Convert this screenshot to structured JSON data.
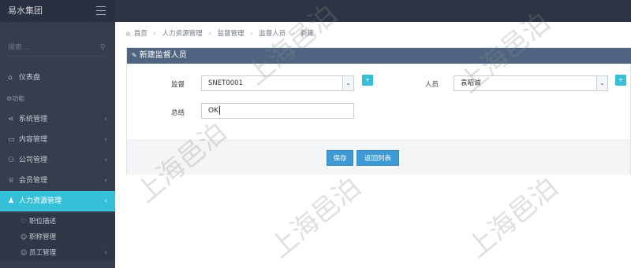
{
  "topbar": {
    "brand": "易水集团",
    "menu_icon": "hamburger-icon"
  },
  "sidebar": {
    "search_placeholder": "搜索...",
    "search_icon": "search-icon",
    "dashboard": {
      "label": "仪表盘",
      "icon": "home-icon"
    },
    "section_label": "功能",
    "items": [
      {
        "label": "系统管理",
        "icon": "share-icon"
      },
      {
        "label": "内容管理",
        "icon": "card-icon"
      },
      {
        "label": "公司管理",
        "icon": "sitemap-icon"
      },
      {
        "label": "会员管理",
        "icon": "graduation-icon"
      },
      {
        "label": "人力资源管理",
        "icon": "users-icon"
      }
    ],
    "sub_items": [
      {
        "label": "职位描述",
        "icon": "heart-icon"
      },
      {
        "label": "职称管理",
        "icon": "user-icon"
      },
      {
        "label": "员工管理",
        "icon": "user-icon"
      }
    ]
  },
  "breadcrumb": [
    "首页",
    "人力资源管理",
    "监督管理",
    "监督人员",
    "新建"
  ],
  "panel": {
    "title": "新建监督人员",
    "supervisor_label": "监督",
    "supervisor_value": "SNET0001",
    "person_label": "人员",
    "person_value": "袁昭诚",
    "summary_label": "总结",
    "summary_value": "OK",
    "save_label": "保存",
    "back_label": "返回列表"
  },
  "watermark": "上海邑泊",
  "colors": {
    "accent": "#35c0d8",
    "panel_header": "#4e6481",
    "sidebar": "#363d4d",
    "button": "#3d9ad6"
  }
}
